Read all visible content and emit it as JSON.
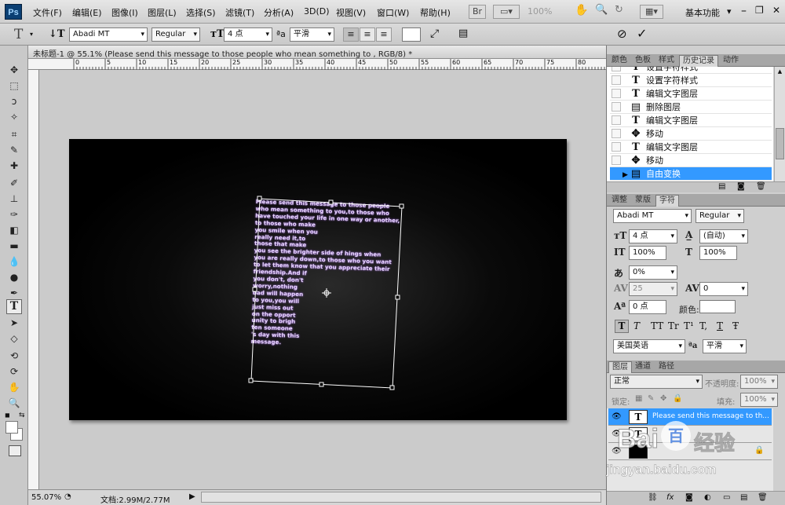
{
  "app": {
    "logo": "Ps"
  },
  "menu": [
    "文件(F)",
    "编辑(E)",
    "图像(I)",
    "图层(L)",
    "选择(S)",
    "滤镜(T)",
    "分析(A)",
    "3D(D)",
    "视图(V)",
    "窗口(W)",
    "帮助(H)"
  ],
  "menubar_right": {
    "zoom": "100%",
    "workspace": "基本功能"
  },
  "options": {
    "font_family": "Abadi MT",
    "font_style": "Regular",
    "font_size": "4 点",
    "antialias": "平滑"
  },
  "document": {
    "tab_title": "未标题-1 @ 55.1% (Please send this message to those people who mean something to , RGB/8) *",
    "ruler_ticks": [
      "0",
      "5",
      "10",
      "15",
      "20",
      "25",
      "30",
      "35",
      "40",
      "45",
      "50",
      "55",
      "60",
      "65",
      "70",
      "75",
      "80",
      "85",
      "90"
    ],
    "text_lines": [
      "Please send this message to those people",
      "who mean something to you,to those who",
      "have touched your life in one way or another,",
      "to those who make",
      "you smile when you",
      "really need it,to",
      "those that make",
      "you see the brighter side of hings when",
      "you are really down,to those who you want",
      "to let them know that you appreciate their",
      "friendship.And if",
      "you don't, don't",
      "worry,nothing",
      "bad will happen",
      "to you,you will",
      "just miss out",
      "on the opport",
      "unity to brigh",
      "ten someone",
      "'s day with this",
      "message."
    ]
  },
  "status": {
    "zoom": "55.07%",
    "doc_info": "文档:2.99M/2.77M"
  },
  "history_panel": {
    "tabs": [
      "颜色",
      "色板",
      "样式",
      "历史记录",
      "动作"
    ],
    "active_tab": "历史记录",
    "items": [
      {
        "icon": "text",
        "label": "设置字符样式"
      },
      {
        "icon": "text",
        "label": "编辑文字图层"
      },
      {
        "icon": "layer",
        "label": "删除图层"
      },
      {
        "icon": "text",
        "label": "编辑文字图层"
      },
      {
        "icon": "move",
        "label": "移动"
      },
      {
        "icon": "text",
        "label": "编辑文字图层"
      },
      {
        "icon": "move",
        "label": "移动"
      },
      {
        "icon": "layer",
        "label": "自由变换"
      }
    ],
    "partial_label": "设置字符样式"
  },
  "character_panel": {
    "tabs": [
      "调整",
      "蒙版",
      "字符"
    ],
    "active_tab": "字符",
    "font_family": "Abadi MT",
    "font_style": "Regular",
    "size": "4 点",
    "leading": "(自动)",
    "vertical_scale": "100%",
    "horizontal_scale": "100%",
    "tracking_percent": "0%",
    "kerning": "25",
    "tracking": "0",
    "baseline_shift": "0 点",
    "color_label": "颜色:",
    "style_buttons": [
      "T",
      "T",
      "TT",
      "Tr",
      "T¹",
      "T,",
      "T",
      "Ŧ"
    ],
    "language": "美国英语",
    "antialias": "平滑"
  },
  "layers_panel": {
    "tabs": [
      "图层",
      "通道",
      "路径"
    ],
    "active_tab": "图层",
    "blend_mode": "正常",
    "opacity_label": "不透明度:",
    "opacity": "100%",
    "lock_label": "锁定:",
    "fill_label": "填充:",
    "fill": "100%",
    "layers": [
      {
        "name": "Please send this message to th...",
        "selected": true
      },
      {
        "name": "",
        "selected": false
      },
      {
        "name": "",
        "selected": false
      }
    ]
  },
  "watermark": {
    "brand": "Bai",
    "brand2": "百",
    "product": "经验",
    "url": "jingyan.baidu.com"
  },
  "colors": {
    "selection": "#3399ff",
    "canvas_bg": "#cbcbcb",
    "text_glow": "#b070ff"
  }
}
